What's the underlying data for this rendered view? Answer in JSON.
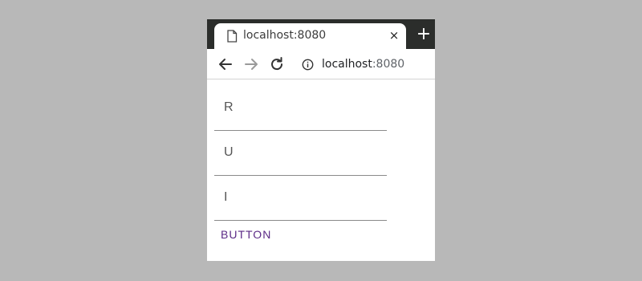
{
  "browser": {
    "tab": {
      "title": "localhost:8080",
      "favicon": "page-icon",
      "close_icon": "close-icon",
      "close_glyph": "×"
    },
    "new_tab_glyph": "+",
    "toolbar": {
      "back_icon": "arrow-left-icon",
      "forward_icon": "arrow-right-icon",
      "reload_icon": "reload-icon",
      "info_icon": "info-icon",
      "url_host": "localhost",
      "url_port": ":8080"
    }
  },
  "form": {
    "fields": [
      {
        "value": "R",
        "placeholder": ""
      },
      {
        "value": "U",
        "placeholder": ""
      },
      {
        "value": "I",
        "placeholder": ""
      }
    ],
    "button_label": "BUTTON",
    "accent": "#5b2a86"
  }
}
